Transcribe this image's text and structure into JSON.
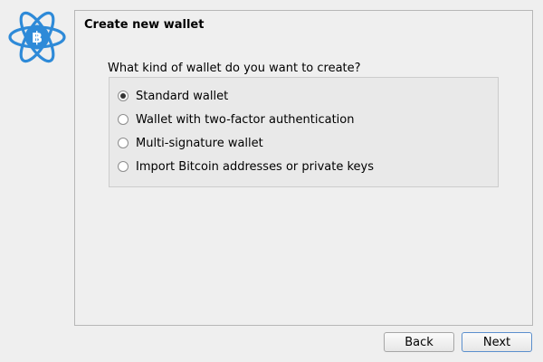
{
  "app": {
    "logo": "electrum-bitcoin-atom-logo",
    "accent_color": "#2e8ad8"
  },
  "page": {
    "title": "Create new wallet",
    "question": "What kind of wallet do you want to create?"
  },
  "options": [
    {
      "label": "Standard wallet",
      "selected": true
    },
    {
      "label": "Wallet with two-factor authentication",
      "selected": false
    },
    {
      "label": "Multi-signature wallet",
      "selected": false
    },
    {
      "label": "Import Bitcoin addresses or private keys",
      "selected": false
    }
  ],
  "buttons": {
    "back": "Back",
    "next": "Next"
  }
}
